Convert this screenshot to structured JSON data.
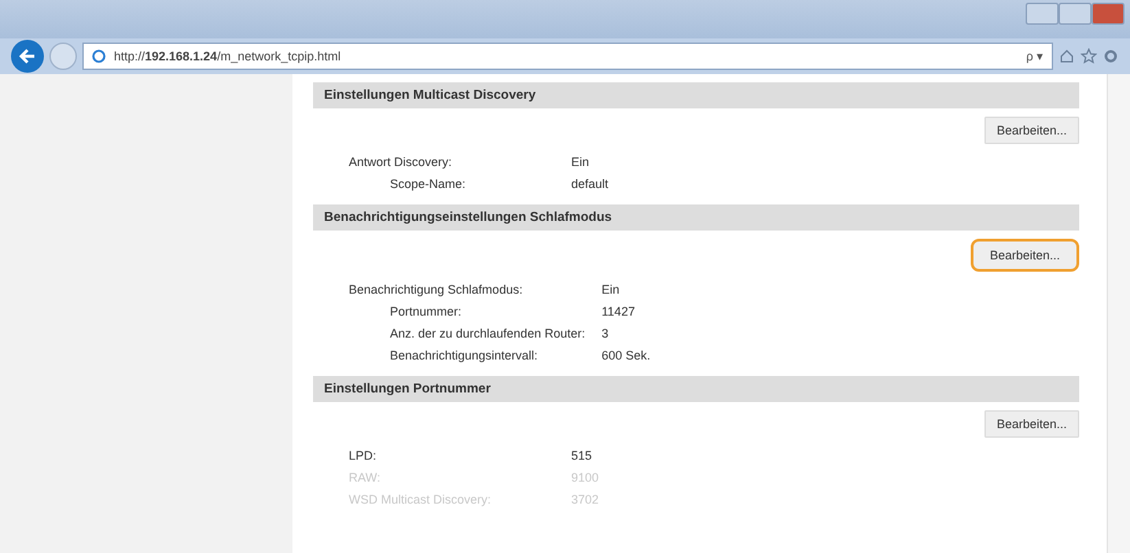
{
  "browser": {
    "url_prefix": "http://",
    "url_host": "192.168.1.24",
    "url_path": "/m_network_tcpip.html",
    "search_glyph": "ρ ▾"
  },
  "sections": [
    {
      "title": "Einstellungen Multicast Discovery",
      "button": {
        "label": "Bearbeiten...",
        "highlighted": false
      },
      "rows": [
        {
          "label": "Antwort Discovery:",
          "value": "Ein",
          "faded": false,
          "children": [
            {
              "label": "Scope-Name:",
              "value": "default",
              "faded": false
            }
          ]
        }
      ]
    },
    {
      "title": "Benachrichtigungseinstellungen Schlafmodus",
      "button": {
        "label": "Bearbeiten...",
        "highlighted": true
      },
      "rows": [
        {
          "label": "Benachrichtigung Schlafmodus:",
          "value": "Ein",
          "faded": false,
          "children": [
            {
              "label": "Portnummer:",
              "value": "11427",
              "faded": false
            },
            {
              "label": "Anz. der zu durchlaufenden Router:",
              "value": "3",
              "faded": false
            },
            {
              "label": "Benachrichtigungsintervall:",
              "value": "600 Sek.",
              "faded": false
            }
          ]
        }
      ]
    },
    {
      "title": "Einstellungen Portnummer",
      "button": {
        "label": "Bearbeiten...",
        "highlighted": false
      },
      "rows": [
        {
          "label": "LPD:",
          "value": "515",
          "faded": false
        },
        {
          "label": "RAW:",
          "value": "9100",
          "faded": true
        },
        {
          "label": "WSD Multicast Discovery:",
          "value": "3702",
          "faded": true
        }
      ]
    }
  ]
}
